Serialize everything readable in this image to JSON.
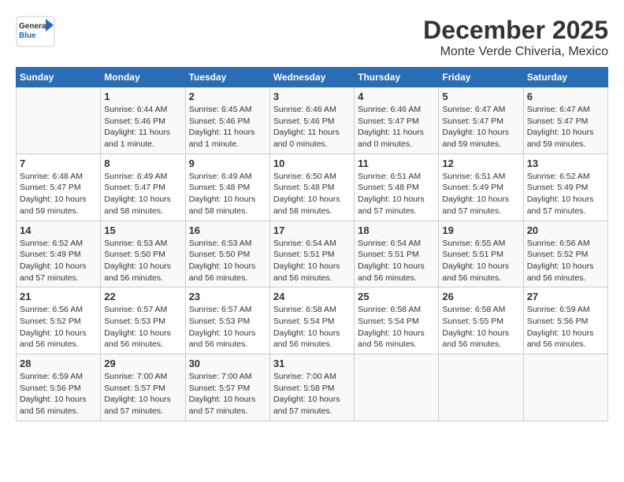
{
  "header": {
    "logo_general": "General",
    "logo_blue": "Blue",
    "title": "December 2025",
    "subtitle": "Monte Verde Chiveria, Mexico"
  },
  "weekdays": [
    "Sunday",
    "Monday",
    "Tuesday",
    "Wednesday",
    "Thursday",
    "Friday",
    "Saturday"
  ],
  "weeks": [
    [
      {
        "day": "",
        "info": ""
      },
      {
        "day": "1",
        "info": "Sunrise: 6:44 AM\nSunset: 5:46 PM\nDaylight: 11 hours\nand 1 minute."
      },
      {
        "day": "2",
        "info": "Sunrise: 6:45 AM\nSunset: 5:46 PM\nDaylight: 11 hours\nand 1 minute."
      },
      {
        "day": "3",
        "info": "Sunrise: 6:46 AM\nSunset: 5:46 PM\nDaylight: 11 hours\nand 0 minutes."
      },
      {
        "day": "4",
        "info": "Sunrise: 6:46 AM\nSunset: 5:47 PM\nDaylight: 11 hours\nand 0 minutes."
      },
      {
        "day": "5",
        "info": "Sunrise: 6:47 AM\nSunset: 5:47 PM\nDaylight: 10 hours\nand 59 minutes."
      },
      {
        "day": "6",
        "info": "Sunrise: 6:47 AM\nSunset: 5:47 PM\nDaylight: 10 hours\nand 59 minutes."
      }
    ],
    [
      {
        "day": "7",
        "info": "Sunrise: 6:48 AM\nSunset: 5:47 PM\nDaylight: 10 hours\nand 59 minutes."
      },
      {
        "day": "8",
        "info": "Sunrise: 6:49 AM\nSunset: 5:47 PM\nDaylight: 10 hours\nand 58 minutes."
      },
      {
        "day": "9",
        "info": "Sunrise: 6:49 AM\nSunset: 5:48 PM\nDaylight: 10 hours\nand 58 minutes."
      },
      {
        "day": "10",
        "info": "Sunrise: 6:50 AM\nSunset: 5:48 PM\nDaylight: 10 hours\nand 58 minutes."
      },
      {
        "day": "11",
        "info": "Sunrise: 6:51 AM\nSunset: 5:48 PM\nDaylight: 10 hours\nand 57 minutes."
      },
      {
        "day": "12",
        "info": "Sunrise: 6:51 AM\nSunset: 5:49 PM\nDaylight: 10 hours\nand 57 minutes."
      },
      {
        "day": "13",
        "info": "Sunrise: 6:52 AM\nSunset: 5:49 PM\nDaylight: 10 hours\nand 57 minutes."
      }
    ],
    [
      {
        "day": "14",
        "info": "Sunrise: 6:52 AM\nSunset: 5:49 PM\nDaylight: 10 hours\nand 57 minutes."
      },
      {
        "day": "15",
        "info": "Sunrise: 6:53 AM\nSunset: 5:50 PM\nDaylight: 10 hours\nand 56 minutes."
      },
      {
        "day": "16",
        "info": "Sunrise: 6:53 AM\nSunset: 5:50 PM\nDaylight: 10 hours\nand 56 minutes."
      },
      {
        "day": "17",
        "info": "Sunrise: 6:54 AM\nSunset: 5:51 PM\nDaylight: 10 hours\nand 56 minutes."
      },
      {
        "day": "18",
        "info": "Sunrise: 6:54 AM\nSunset: 5:51 PM\nDaylight: 10 hours\nand 56 minutes."
      },
      {
        "day": "19",
        "info": "Sunrise: 6:55 AM\nSunset: 5:51 PM\nDaylight: 10 hours\nand 56 minutes."
      },
      {
        "day": "20",
        "info": "Sunrise: 6:56 AM\nSunset: 5:52 PM\nDaylight: 10 hours\nand 56 minutes."
      }
    ],
    [
      {
        "day": "21",
        "info": "Sunrise: 6:56 AM\nSunset: 5:52 PM\nDaylight: 10 hours\nand 56 minutes."
      },
      {
        "day": "22",
        "info": "Sunrise: 6:57 AM\nSunset: 5:53 PM\nDaylight: 10 hours\nand 56 minutes."
      },
      {
        "day": "23",
        "info": "Sunrise: 6:57 AM\nSunset: 5:53 PM\nDaylight: 10 hours\nand 56 minutes."
      },
      {
        "day": "24",
        "info": "Sunrise: 6:58 AM\nSunset: 5:54 PM\nDaylight: 10 hours\nand 56 minutes."
      },
      {
        "day": "25",
        "info": "Sunrise: 6:58 AM\nSunset: 5:54 PM\nDaylight: 10 hours\nand 56 minutes."
      },
      {
        "day": "26",
        "info": "Sunrise: 6:58 AM\nSunset: 5:55 PM\nDaylight: 10 hours\nand 56 minutes."
      },
      {
        "day": "27",
        "info": "Sunrise: 6:59 AM\nSunset: 5:56 PM\nDaylight: 10 hours\nand 56 minutes."
      }
    ],
    [
      {
        "day": "28",
        "info": "Sunrise: 6:59 AM\nSunset: 5:56 PM\nDaylight: 10 hours\nand 56 minutes."
      },
      {
        "day": "29",
        "info": "Sunrise: 7:00 AM\nSunset: 5:57 PM\nDaylight: 10 hours\nand 57 minutes."
      },
      {
        "day": "30",
        "info": "Sunrise: 7:00 AM\nSunset: 5:57 PM\nDaylight: 10 hours\nand 57 minutes."
      },
      {
        "day": "31",
        "info": "Sunrise: 7:00 AM\nSunset: 5:58 PM\nDaylight: 10 hours\nand 57 minutes."
      },
      {
        "day": "",
        "info": ""
      },
      {
        "day": "",
        "info": ""
      },
      {
        "day": "",
        "info": ""
      }
    ]
  ]
}
